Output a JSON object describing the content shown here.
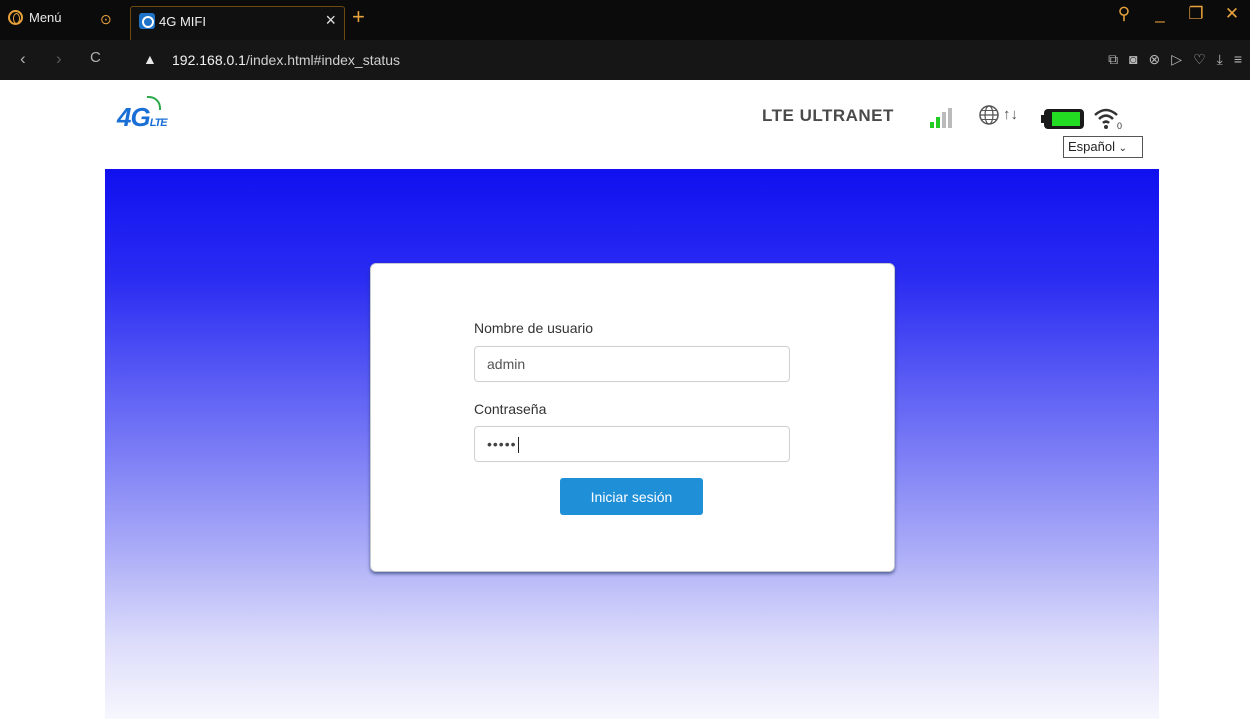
{
  "browser": {
    "menu_label": "Menú",
    "tab_title": "4G MIFI",
    "url_host": "192.168.0.1",
    "url_path": "/index.html#index_status"
  },
  "header": {
    "logo_main": "4G",
    "logo_sub": "LTE",
    "operator": "LTE ULTRANET",
    "language": "Español",
    "wifi_clients": "0",
    "signal_bars_active": 2,
    "signal_bars_total": 4,
    "colors": {
      "signal_active": "#22cc22",
      "signal_inactive": "#bbbbbb",
      "battery": "#22dd22"
    }
  },
  "login": {
    "username_label": "Nombre de usuario",
    "username_value": "admin",
    "password_label": "Contraseña",
    "password_value": "•••••",
    "submit_label": "Iniciar sesión",
    "button_color": "#1f8fd8"
  }
}
